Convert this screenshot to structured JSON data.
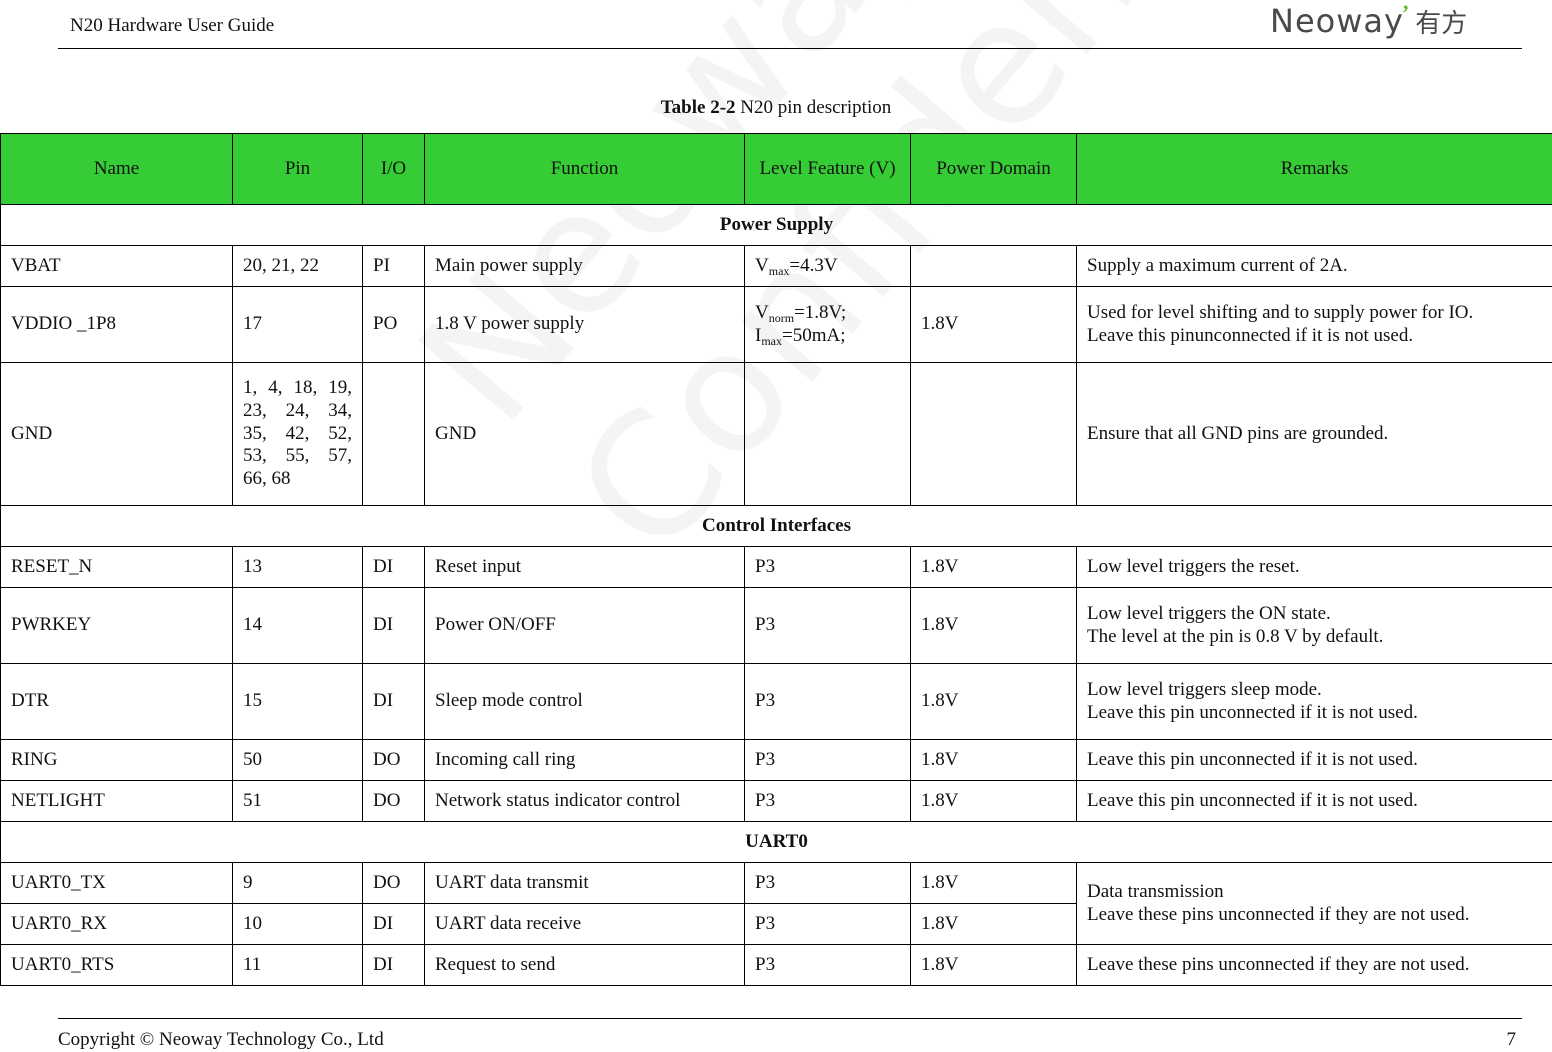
{
  "header": {
    "doc_title": "N20 Hardware User Guide",
    "logo_text": "Neoway",
    "logo_accent": "’",
    "logo_cn": "有方"
  },
  "caption": {
    "label": "Table 2-2",
    "text": " N20 pin description"
  },
  "table": {
    "columns": [
      "Name",
      "Pin",
      "I/O",
      "Function",
      "Level Feature (V)",
      "Power Domain",
      "Remarks"
    ],
    "sections": [
      {
        "title": "Power Supply",
        "rows": [
          {
            "name": "VBAT",
            "pin": "20, 21, 22",
            "io": "PI",
            "function": "Main power supply",
            "level": [
              {
                "base": "V",
                "sub": "max",
                "rest": "=4.3V"
              }
            ],
            "domain": "",
            "remarks": [
              "Supply a maximum current of 2A."
            ]
          },
          {
            "name": "VDDIO _1P8",
            "pin": "17",
            "io": "PO",
            "function": "1.8 V power supply",
            "level": [
              {
                "base": "V",
                "sub": "norm",
                "rest": "=1.8V;"
              },
              {
                "base": "I",
                "sub": "max",
                "rest": "=50mA;"
              }
            ],
            "domain": "1.8V",
            "remarks": [
              "Used for level shifting and to supply power for IO.",
              "Leave this pinunconnected if it is not used."
            ]
          },
          {
            "name": "GND",
            "pin": "1, 4, 18, 19, 23, 24, 34, 35, 42, 52, 53, 55, 57, 66, 68",
            "io": "",
            "function": "GND",
            "level": [],
            "domain": "",
            "remarks": [
              "Ensure that all GND pins are grounded."
            ]
          }
        ]
      },
      {
        "title": "Control Interfaces",
        "rows": [
          {
            "name": "RESET_N",
            "pin": "13",
            "io": "DI",
            "function": "Reset input",
            "level_text": "P3",
            "domain": "1.8V",
            "remarks": [
              "Low level triggers the reset."
            ]
          },
          {
            "name": "PWRKEY",
            "pin": "14",
            "io": "DI",
            "function": "Power ON/OFF",
            "level_text": "P3",
            "domain": "1.8V",
            "remarks": [
              "Low level triggers the ON state.",
              "The level at the pin is 0.8 V by default."
            ]
          },
          {
            "name": "DTR",
            "pin": "15",
            "io": "DI",
            "function": "Sleep mode control",
            "level_text": "P3",
            "domain": "1.8V",
            "remarks": [
              "Low level triggers sleep mode.",
              "Leave this pin unconnected if it is not used."
            ]
          },
          {
            "name": "RING",
            "pin": "50",
            "io": "DO",
            "function": "Incoming call ring",
            "level_text": "P3",
            "domain": "1.8V",
            "remarks": [
              "Leave this pin unconnected if it is not used."
            ]
          },
          {
            "name": "NETLIGHT",
            "pin": "51",
            "io": "DO",
            "function": "Network status indicator control",
            "level_text": "P3",
            "domain": "1.8V",
            "remarks": [
              "Leave this pin unconnected if it is not used."
            ]
          }
        ]
      },
      {
        "title": "UART0",
        "rows": [
          {
            "name": "UART0_TX",
            "pin": "9",
            "io": "DO",
            "function": "UART data transmit",
            "level_text": "P3",
            "domain": "1.8V",
            "remarks": [
              "Data transmission",
              "Leave these pins unconnected if they are not used."
            ],
            "remarks_rowspan": 2
          },
          {
            "name": "UART0_RX",
            "pin": "10",
            "io": "DI",
            "function": "UART data receive",
            "level_text": "P3",
            "domain": "1.8V",
            "remarks_merged": true
          },
          {
            "name": "UART0_RTS",
            "pin": "11",
            "io": "DI",
            "function": "Request to send",
            "level_text": "P3",
            "domain": "1.8V",
            "remarks": [
              "Leave these pins unconnected if they are not used."
            ]
          }
        ]
      }
    ]
  },
  "watermark": [
    "Neoway",
    "Confidential"
  ],
  "footer": {
    "copyright": "Copyright © Neoway Technology Co., Ltd",
    "page_number": "7"
  },
  "colors": {
    "header_green": "#35cc35",
    "logo_gray": "#4a4a4a",
    "logo_green": "#63b632"
  }
}
